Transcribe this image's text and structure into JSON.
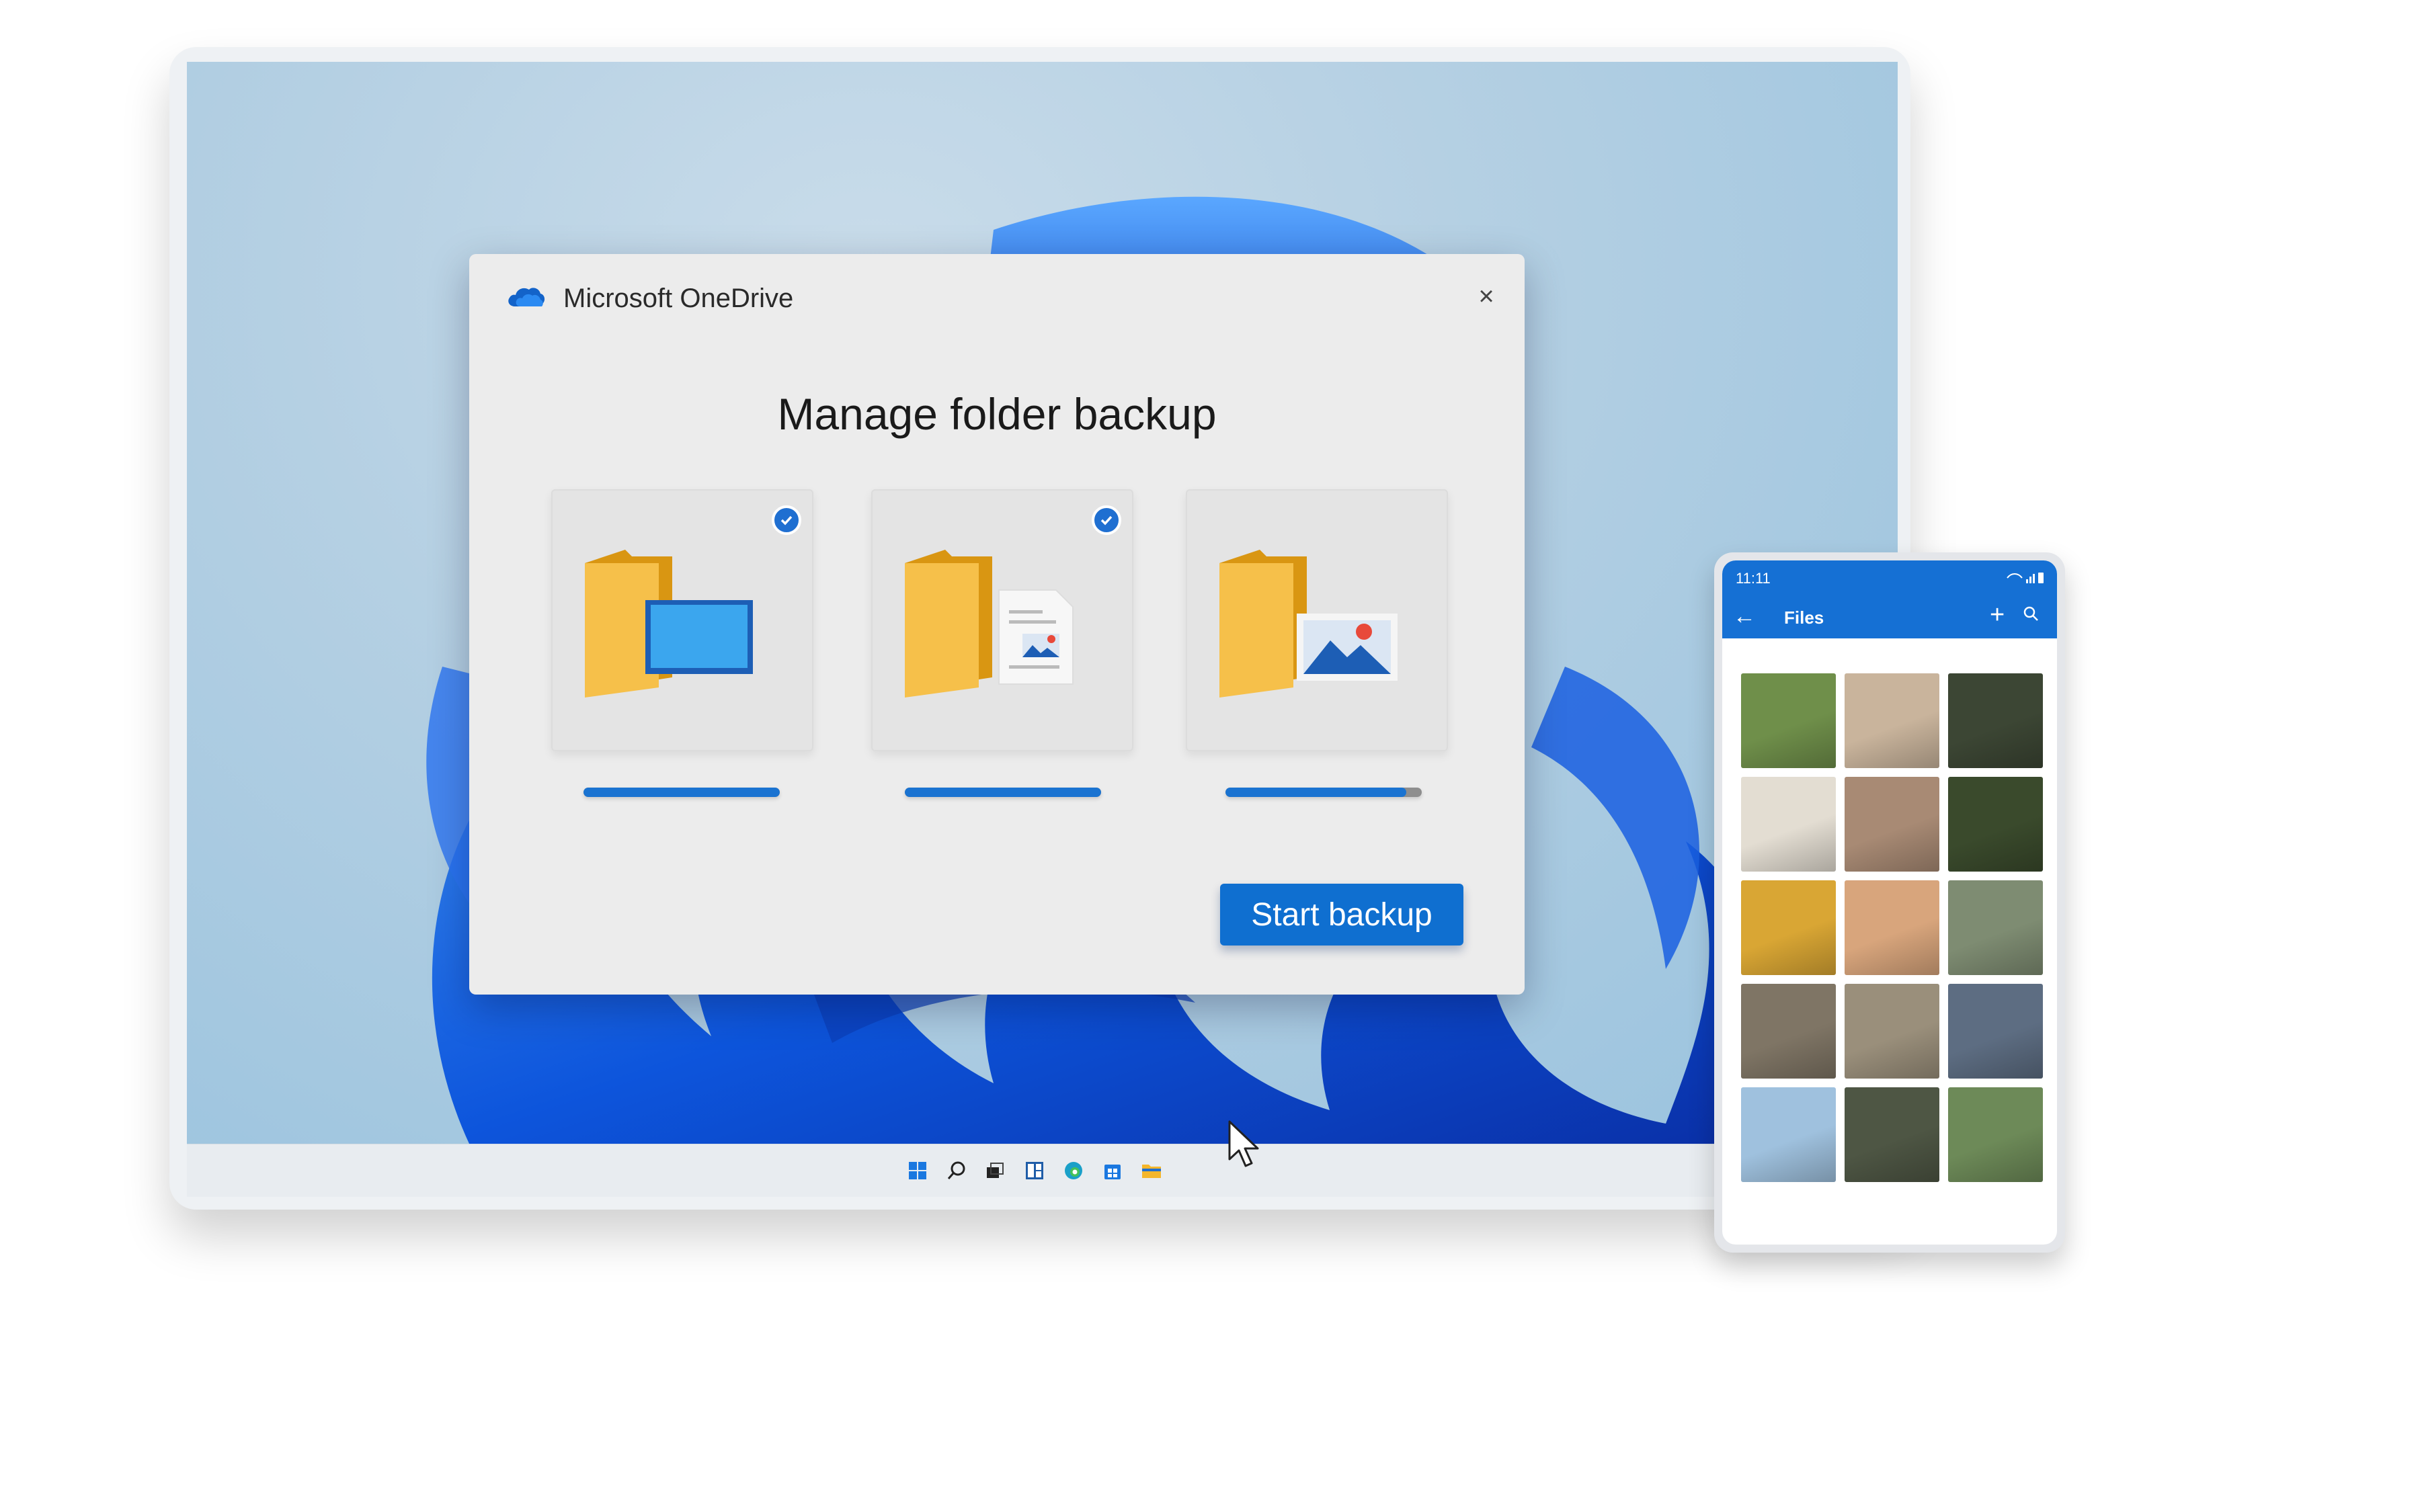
{
  "dialog": {
    "app_title": "Microsoft OneDrive",
    "heading": "Manage folder backup",
    "close_glyph": "×",
    "start_button": "Start backup",
    "folders": [
      {
        "name": "desktop-folder",
        "icon": "desktop-folder-icon",
        "checked": true,
        "progress": 1.0
      },
      {
        "name": "documents-folder",
        "icon": "documents-folder-icon",
        "checked": true,
        "progress": 1.0
      },
      {
        "name": "pictures-folder",
        "icon": "pictures-folder-icon",
        "checked": false,
        "progress": 0.92
      }
    ]
  },
  "phone": {
    "time": "11:11",
    "title": "Files",
    "back_glyph": "←",
    "add_glyph": "+",
    "photos": [
      {
        "name": "tree-field-photo",
        "color": "#6f8f4a"
      },
      {
        "name": "coffee-cup-photo",
        "color": "#c9b49c"
      },
      {
        "name": "food-bowl-photo",
        "color": "#3c4634"
      },
      {
        "name": "ceramics-photo",
        "color": "#e3ddd2"
      },
      {
        "name": "architecture-photo",
        "color": "#a88a74"
      },
      {
        "name": "salad-photo",
        "color": "#3a4a2c"
      },
      {
        "name": "yellow-flowers-photo",
        "color": "#d9a634"
      },
      {
        "name": "cat-stretching-photo",
        "color": "#d8a57c"
      },
      {
        "name": "people-walking-photo",
        "color": "#7e8c72"
      },
      {
        "name": "kitten-photo",
        "color": "#7f7565"
      },
      {
        "name": "family-photo",
        "color": "#9a8f7b"
      },
      {
        "name": "person-closeup-photo",
        "color": "#5d6d82"
      },
      {
        "name": "sky-clouds-photo",
        "color": "#9fc1de"
      },
      {
        "name": "wildflowers-photo",
        "color": "#4e5644"
      },
      {
        "name": "green-building-photo",
        "color": "#6d8a58"
      }
    ]
  },
  "taskbar": {
    "icons": [
      "start-icon",
      "search-icon",
      "task-view-icon",
      "widgets-icon",
      "edge-icon",
      "store-icon",
      "file-explorer-icon"
    ]
  },
  "colors": {
    "accent": "#0f6fd0",
    "dialog_bg": "#ececec",
    "phone_header": "#1570d4"
  }
}
